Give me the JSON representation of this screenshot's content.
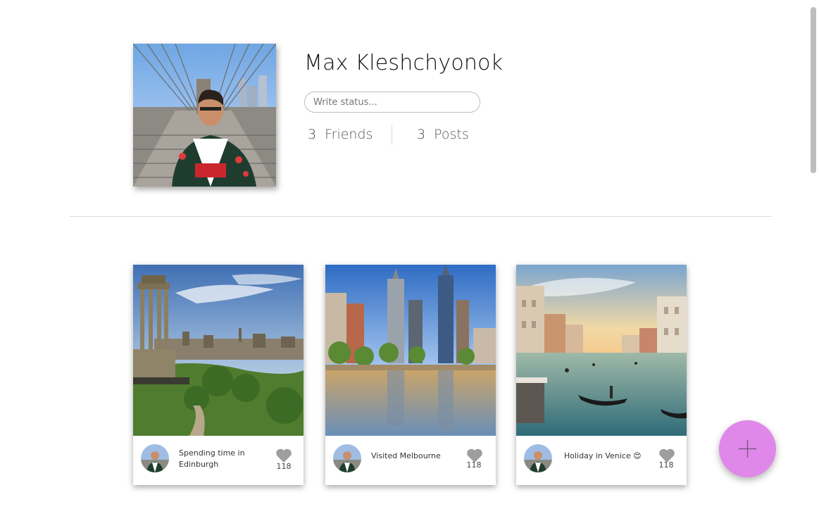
{
  "profile": {
    "name": "Max Kleshchyonok",
    "status_placeholder": "Write status...",
    "friends_count": "3",
    "friends_label": "Friends",
    "posts_count": "3",
    "posts_label": "Posts"
  },
  "posts": [
    {
      "caption": "Spending time in Edinburgh",
      "likes": "118",
      "image": "edinburgh-photo"
    },
    {
      "caption": "Visited Melbourne",
      "likes": "118",
      "image": "melbourne-photo"
    },
    {
      "caption": "Holiday in Venice 😍",
      "likes": "118",
      "image": "venice-photo"
    }
  ],
  "icons": {
    "like": "heart-icon",
    "add": "plus-icon"
  },
  "colors": {
    "fab": "#e087ea",
    "heart": "#9e9e9e"
  }
}
